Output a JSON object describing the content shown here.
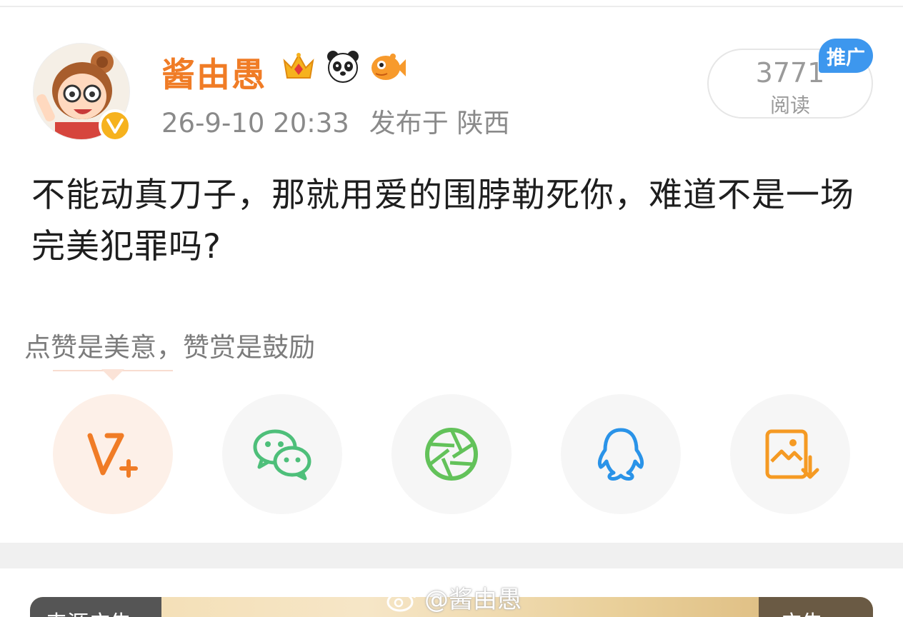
{
  "author": {
    "name": "酱由愚",
    "verified_icon": "verified-v-icon",
    "badges": [
      "crown-badge-icon",
      "panda-badge-icon",
      "fish-badge-icon"
    ]
  },
  "post": {
    "time": "26-9-10 20:33",
    "location": "发布于 陕西",
    "text": "不能动真刀子，那就用爱的围脖勒死你，难道不是一场完美犯罪吗?"
  },
  "reads": {
    "count": "3771",
    "label": "阅读",
    "promo": "推广"
  },
  "tip": "点赞是美意，赞赏是鼓励",
  "share": [
    {
      "name": "vplus-share",
      "icon": "vplus-icon",
      "color": "#f07c26"
    },
    {
      "name": "wechat-share",
      "icon": "wechat-icon",
      "color": "#4ebf7a"
    },
    {
      "name": "moments-share",
      "icon": "moments-icon",
      "color": "#63c25a"
    },
    {
      "name": "qq-share",
      "icon": "qq-icon",
      "color": "#2a93e8"
    },
    {
      "name": "save-image-share",
      "icon": "save-image-icon",
      "color": "#f59a23"
    }
  ],
  "ad": {
    "left_label": "来源广告",
    "right_label": "广告"
  },
  "watermark": "@酱由愚",
  "colors": {
    "accent": "#f07c26",
    "promo_blue": "#3d97ee",
    "verified_gold": "#f6b21e"
  }
}
